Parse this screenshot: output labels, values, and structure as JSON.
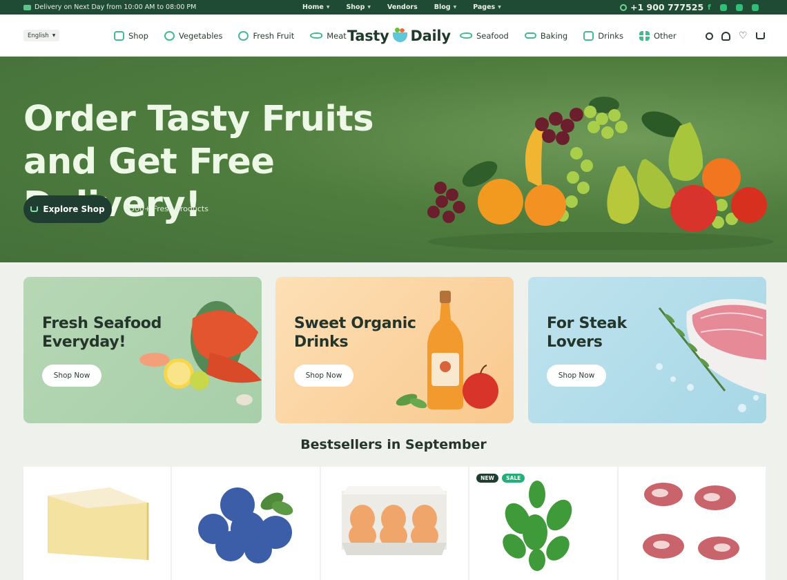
{
  "topbar": {
    "delivery_text": "Delivery on Next Day from 10:00 AM to 08:00 PM",
    "nav": [
      {
        "label": "Home"
      },
      {
        "label": "Shop"
      },
      {
        "label": "Vendors"
      },
      {
        "label": "Blog"
      },
      {
        "label": "Pages"
      }
    ],
    "phone": "+1 900 777525",
    "social_icons": [
      "facebook-icon",
      "instagram-icon",
      "chat-icon",
      "mail-icon"
    ],
    "social_facebook_glyph": "f"
  },
  "header": {
    "language": "English",
    "logo_left": "Tasty",
    "logo_right": "Daily",
    "nav_left": [
      {
        "label": "Shop",
        "icon": "shop-icon"
      },
      {
        "label": "Vegetables",
        "icon": "vegetables-icon"
      },
      {
        "label": "Fresh Fruit",
        "icon": "fruit-icon"
      },
      {
        "label": "Meat",
        "icon": "meat-icon"
      }
    ],
    "nav_right": [
      {
        "label": "Seafood",
        "icon": "seafood-icon"
      },
      {
        "label": "Baking",
        "icon": "baking-icon"
      },
      {
        "label": "Drinks",
        "icon": "drinks-icon"
      },
      {
        "label": "Other",
        "icon": "grid-icon"
      }
    ],
    "heart_glyph": "♡"
  },
  "hero": {
    "title_line1": "Order Tasty Fruits",
    "title_line2": "and Get Free Delivery!",
    "button_label": "Explore Shop",
    "subtext": "2500+ Fresh Products"
  },
  "promos": [
    {
      "title_line1": "Fresh Seafood",
      "title_line2": "Everyday!",
      "button": "Shop Now"
    },
    {
      "title_line1": "Sweet Organic",
      "title_line2": "Drinks",
      "button": "Shop Now"
    },
    {
      "title_line1": "For Steak",
      "title_line2": "Lovers",
      "button": "Shop Now"
    }
  ],
  "bestsellers": {
    "title": "Bestsellers in September",
    "badges": {
      "new": "NEW",
      "sale": "SALE"
    }
  },
  "colors": {
    "topbar_bg": "#1f4a33",
    "hero_bg": "#4f7d3e",
    "accent": "#43b98c",
    "button_dark": "#1f3d30"
  }
}
